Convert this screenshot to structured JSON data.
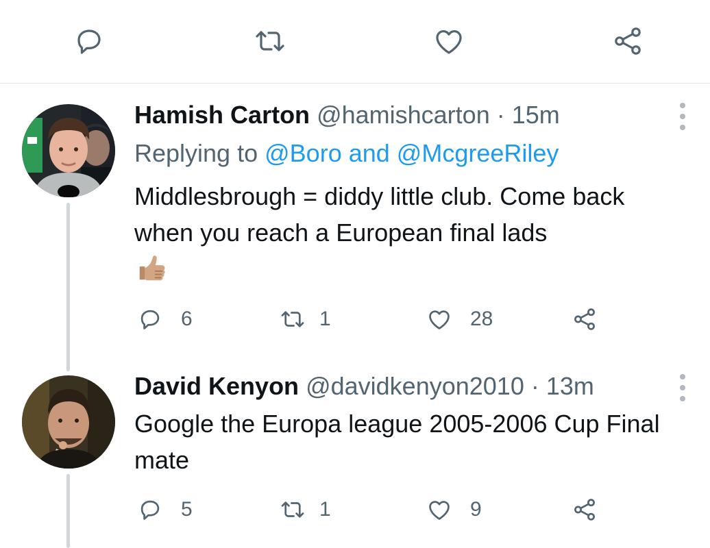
{
  "top_actions": {
    "icons": [
      "reply-icon",
      "retweet-icon",
      "like-icon",
      "share-icon"
    ],
    "stroke_color": "#536471"
  },
  "tweets": [
    {
      "name": "Hamish Carton",
      "handle": "@hamishcarton",
      "separator": "·",
      "time": "15m",
      "replying_prefix": "Replying to",
      "replying_users": "@Boro and @McgreeRiley",
      "text": "Middlesbrough = diddy little club. Come back when you reach a European final lads",
      "emoji": "thumbs-up",
      "reply_count": "6",
      "retweet_count": "1",
      "like_count": "28"
    },
    {
      "name": "David Kenyon",
      "handle": "@davidkenyon2010",
      "separator": "·",
      "time": "13m",
      "text": "Google the Europa league 2005-2006 Cup Final mate",
      "reply_count": "5",
      "retweet_count": "1",
      "like_count": "9"
    }
  ],
  "colors": {
    "link": "#1d9bf0",
    "secondary_text": "#536471",
    "primary_text": "#0f1419",
    "thread_line": "#cfd6dc",
    "divider": "#e3e6ea"
  }
}
